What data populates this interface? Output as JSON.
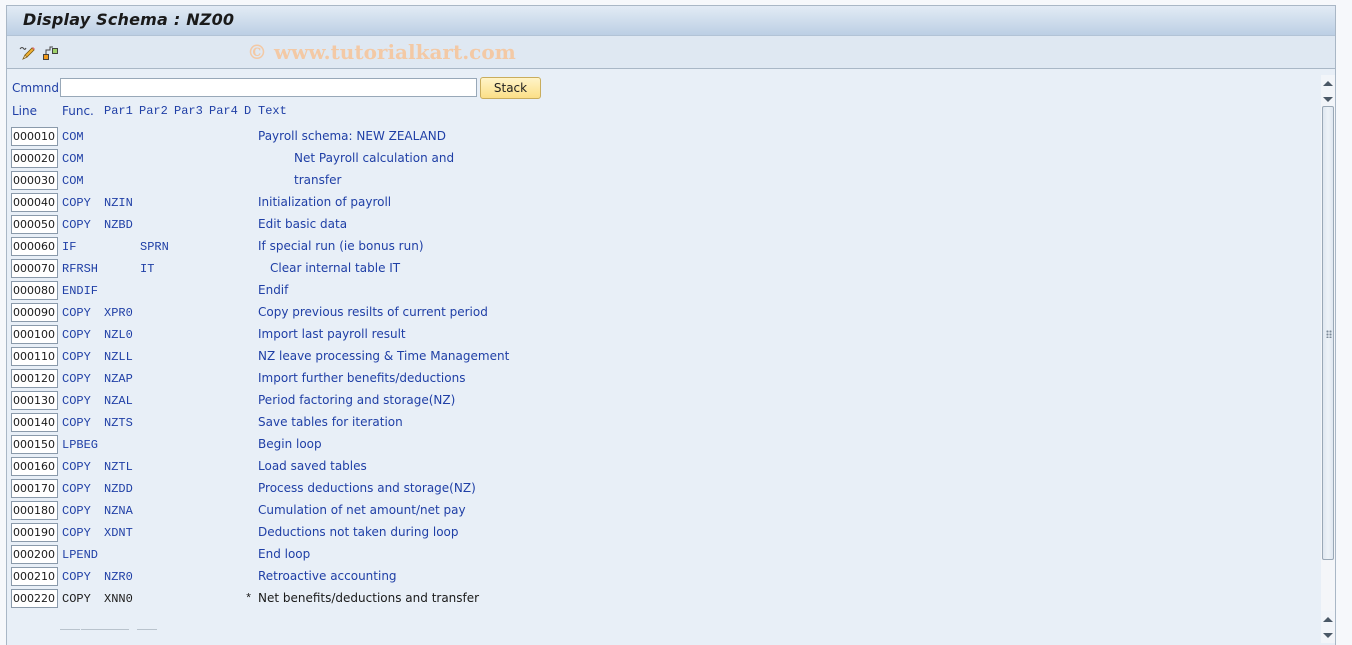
{
  "window": {
    "title": "Display Schema : NZ00"
  },
  "toolbar": {
    "icons": [
      "edit-pencil-icon",
      "hierarchy-structure-icon"
    ],
    "watermark": "© www.tutorialkart.com"
  },
  "command": {
    "label": "Cmmnd",
    "value": "",
    "placeholder": "",
    "stack_button": "Stack"
  },
  "columns": {
    "line": "Line",
    "func": "Func.",
    "par1": "Par1",
    "par2": "Par2",
    "par3": "Par3",
    "par4": "Par4",
    "d": "D",
    "text": "Text"
  },
  "rows": [
    {
      "line": "000010",
      "func": "COM",
      "par1": "",
      "par2": "",
      "d": "",
      "text": "Payroll schema: NEW ZEALAND",
      "indent": 0,
      "style": "blue"
    },
    {
      "line": "000020",
      "func": "COM",
      "par1": "",
      "par2": "",
      "d": "",
      "text": "Net Payroll calculation and",
      "indent": 3,
      "style": "blue"
    },
    {
      "line": "000030",
      "func": "COM",
      "par1": "",
      "par2": "",
      "d": "",
      "text": "transfer",
      "indent": 3,
      "style": "blue"
    },
    {
      "line": "000040",
      "func": "COPY",
      "par1": "NZIN",
      "par2": "",
      "d": "",
      "text": "Initialization of payroll",
      "indent": 0,
      "style": "blue"
    },
    {
      "line": "000050",
      "func": "COPY",
      "par1": "NZBD",
      "par2": "",
      "d": "",
      "text": "Edit basic data",
      "indent": 0,
      "style": "blue"
    },
    {
      "line": "000060",
      "func": "IF",
      "par1": "",
      "par2": "SPRN",
      "d": "",
      "text": "If special run (ie bonus run)",
      "indent": 0,
      "style": "blue"
    },
    {
      "line": "000070",
      "func": "RFRSH",
      "par1": "",
      "par2": "IT",
      "d": "",
      "text": "Clear internal table IT",
      "indent": 1,
      "style": "blue"
    },
    {
      "line": "000080",
      "func": "ENDIF",
      "par1": "",
      "par2": "",
      "d": "",
      "text": "Endif",
      "indent": 0,
      "style": "blue"
    },
    {
      "line": "000090",
      "func": "COPY",
      "par1": "XPR0",
      "par2": "",
      "d": "",
      "text": "Copy previous resilts of current period",
      "indent": 0,
      "style": "blue"
    },
    {
      "line": "000100",
      "func": "COPY",
      "par1": "NZL0",
      "par2": "",
      "d": "",
      "text": "Import last payroll result",
      "indent": 0,
      "style": "blue"
    },
    {
      "line": "000110",
      "func": "COPY",
      "par1": "NZLL",
      "par2": "",
      "d": "",
      "text": "NZ leave processing & Time Management",
      "indent": 0,
      "style": "blue"
    },
    {
      "line": "000120",
      "func": "COPY",
      "par1": "NZAP",
      "par2": "",
      "d": "",
      "text": "Import further benefits/deductions",
      "indent": 0,
      "style": "blue"
    },
    {
      "line": "000130",
      "func": "COPY",
      "par1": "NZAL",
      "par2": "",
      "d": "",
      "text": "Period factoring and storage(NZ)",
      "indent": 0,
      "style": "blue"
    },
    {
      "line": "000140",
      "func": "COPY",
      "par1": "NZTS",
      "par2": "",
      "d": "",
      "text": "Save tables for iteration",
      "indent": 0,
      "style": "blue"
    },
    {
      "line": "000150",
      "func": "LPBEG",
      "par1": "",
      "par2": "",
      "d": "",
      "text": "Begin loop",
      "indent": 0,
      "style": "blue"
    },
    {
      "line": "000160",
      "func": "COPY",
      "par1": "NZTL",
      "par2": "",
      "d": "",
      "text": "Load saved tables",
      "indent": 0,
      "style": "blue"
    },
    {
      "line": "000170",
      "func": "COPY",
      "par1": "NZDD",
      "par2": "",
      "d": "",
      "text": "Process deductions and storage(NZ)",
      "indent": 0,
      "style": "blue"
    },
    {
      "line": "000180",
      "func": "COPY",
      "par1": "NZNA",
      "par2": "",
      "d": "",
      "text": "Cumulation of net amount/net pay",
      "indent": 0,
      "style": "blue"
    },
    {
      "line": "000190",
      "func": "COPY",
      "par1": "XDNT",
      "par2": "",
      "d": "",
      "text": "Deductions not taken during loop",
      "indent": 0,
      "style": "blue"
    },
    {
      "line": "000200",
      "func": "LPEND",
      "par1": "",
      "par2": "",
      "d": "",
      "text": "End loop",
      "indent": 0,
      "style": "blue"
    },
    {
      "line": "000210",
      "func": "COPY",
      "par1": "NZR0",
      "par2": "",
      "d": "",
      "text": "Retroactive accounting",
      "indent": 0,
      "style": "blue"
    },
    {
      "line": "000220",
      "func": "COPY",
      "par1": "XNN0",
      "par2": "",
      "d": "*",
      "text": "Net benefits/deductions and transfer",
      "indent": 0,
      "style": "black"
    }
  ],
  "scrollbar": {
    "up_icon": "arrow-up-icon",
    "down_icon": "arrow-down-icon"
  }
}
